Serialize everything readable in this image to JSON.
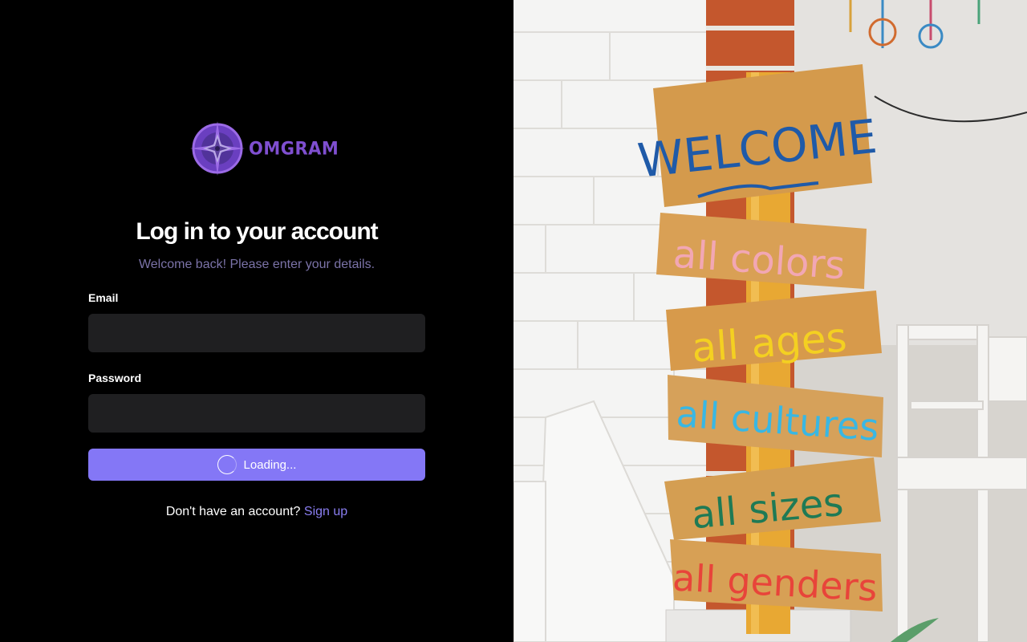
{
  "brand": {
    "name": "OMGRAM",
    "logo_icon": "compass-star-icon",
    "colors": {
      "primary": "#7f4fd0",
      "accent": "#8477f6",
      "link": "#8a7ef2"
    }
  },
  "login": {
    "title": "Log in to your account",
    "subtitle": "Welcome back! Please enter your details.",
    "email_label": "Email",
    "email_value": "",
    "password_label": "Password",
    "password_value": "",
    "submit_label": "Loading...",
    "signup_prompt": "Don't have an account?",
    "signup_link": "Sign up"
  },
  "hero_image": {
    "signs": [
      "WELCOME",
      "all colors",
      "all ages",
      "all cultures",
      "all sizes",
      "all genders"
    ]
  }
}
